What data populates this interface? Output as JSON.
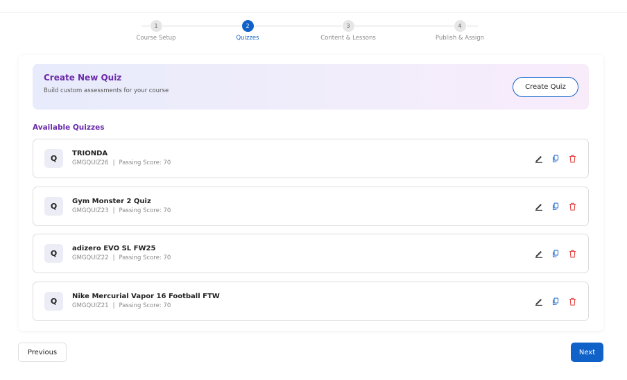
{
  "stepper": {
    "steps": [
      {
        "number": "1",
        "label": "Course Setup"
      },
      {
        "number": "2",
        "label": "Quizzes"
      },
      {
        "number": "3",
        "label": "Content & Lessons"
      },
      {
        "number": "4",
        "label": "Publish & Assign"
      }
    ],
    "active_index": 1,
    "active_color": "#1062c9"
  },
  "banner": {
    "title": "Create New Quiz",
    "subtitle": "Build custom assessments for your course",
    "create_label": "Create Quiz"
  },
  "quizzes_section": {
    "title": "Available Quizzes",
    "badge_letter": "Q",
    "separator": "|",
    "items": [
      {
        "name": "TRIONDA",
        "code": "GMGQUIZ26",
        "passing": "Passing Score: 70"
      },
      {
        "name": "Gym Monster 2 Quiz",
        "code": "GMGQUIZ23",
        "passing": "Passing Score: 70"
      },
      {
        "name": "adizero EVO SL FW25",
        "code": "GMGQUIZ22",
        "passing": "Passing Score: 70"
      },
      {
        "name": "Nike Mercurial Vapor 16 Football FTW",
        "code": "GMGQUIZ21",
        "passing": "Passing Score: 70"
      }
    ],
    "icons": {
      "edit": "pencil-icon",
      "copy": "copy-icon",
      "delete": "trash-icon"
    }
  },
  "footer": {
    "previous_label": "Previous",
    "next_label": "Next"
  },
  "colors": {
    "accent": "#1062c9",
    "heading": "#6a2aa8",
    "delete": "#e53935"
  }
}
